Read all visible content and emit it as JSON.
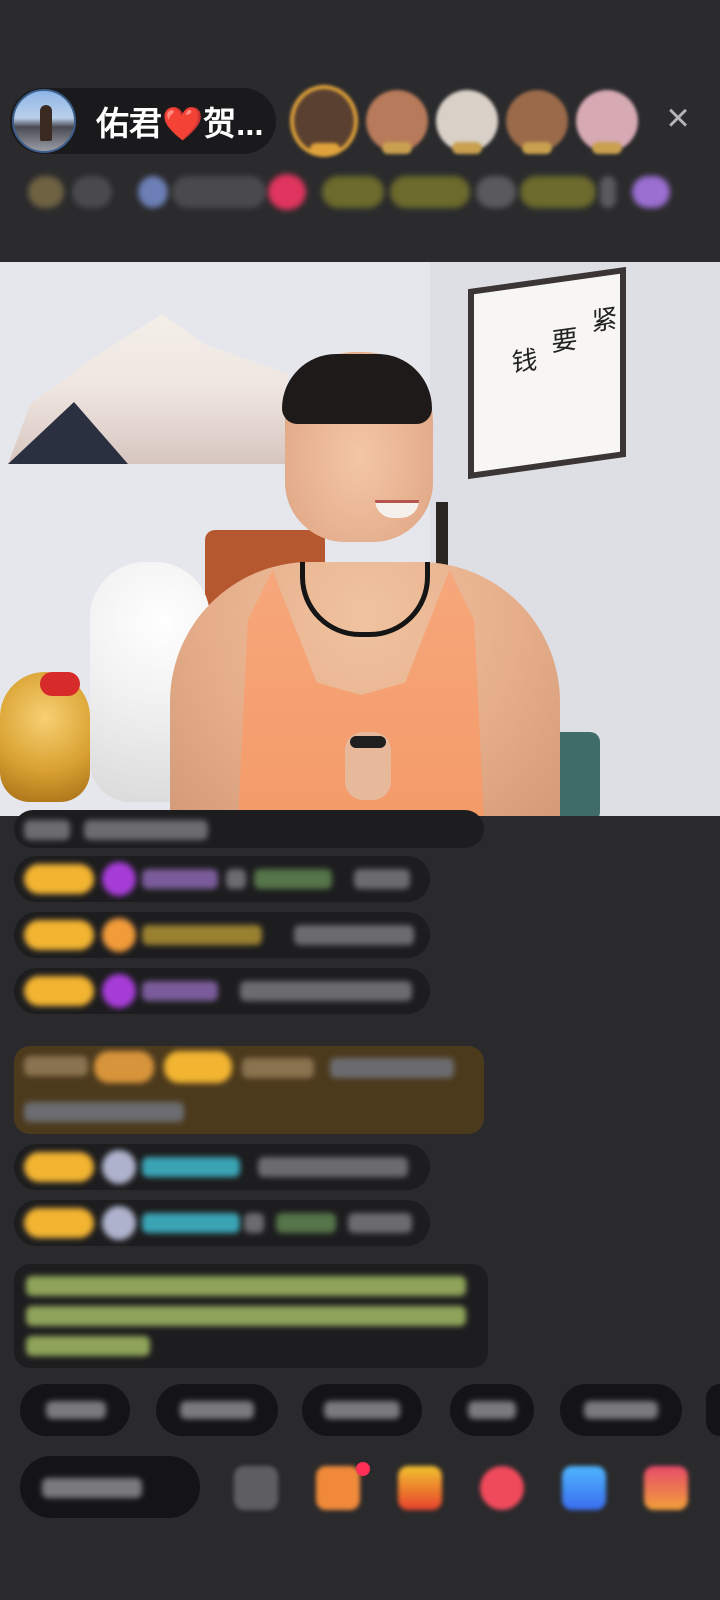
{
  "host": {
    "name": "佑君❤️贺..."
  },
  "topbar": {
    "close_icon": "close-icon",
    "viewers": [
      {
        "name": "viewer-1",
        "color": "#5a4030",
        "badge": "#e0a23a"
      },
      {
        "name": "viewer-2",
        "color": "#b77a5a",
        "badge": "#c9a050"
      },
      {
        "name": "viewer-3",
        "color": "#d9d1c8",
        "badge": "#c9a050"
      },
      {
        "name": "viewer-4",
        "color": "#9a6a4a",
        "badge": "#c9a050"
      },
      {
        "name": "viewer-5",
        "color": "#d6a9b3",
        "badge": "#c9a050"
      }
    ]
  },
  "video": {
    "calligraphy": [
      "紧",
      "要",
      "钱"
    ]
  },
  "colors": {
    "background": "#2a2a2c",
    "accent_gold": "#f2b431",
    "notice_bg": "#4c3a1d"
  }
}
